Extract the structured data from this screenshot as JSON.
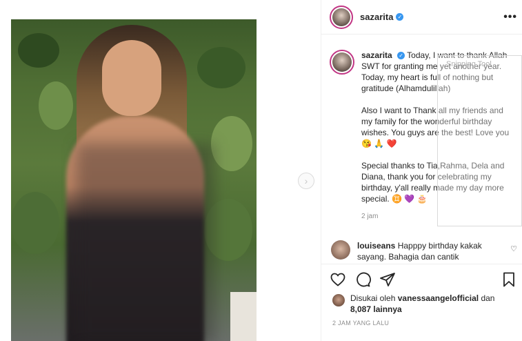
{
  "post": {
    "username": "sazarita",
    "more_label": "•••",
    "caption": {
      "paragraph1": "Today, I want to thank Allah SWT for granting me yet another year. Today, my heart is full of nothing but gratitude (Alhamdulillah)",
      "paragraph2": "Also I want to Thank all my friends and my family for the wonderful birthday wishes. You guys are the best! Love you 😘 🙏 ❤️",
      "paragraph3": "Special thanks to Tia,Rahma, Dela and Diana, thank you for celebrating my birthday, y'all really made my day more special. ♊ 💜 🎂",
      "time": "2 jam"
    },
    "comment": {
      "username": "louiseans",
      "text": "Happpy birthday kakak sayang. Bahagia dan cantik"
    },
    "likes": {
      "prefix": "Disukai oleh",
      "user": "vanessaangelofficial",
      "middle": "dan",
      "count": "8,087 lainnya"
    },
    "timestamp": "2 JAM YANG LALU"
  },
  "overlay": {
    "snipping_tool_label": "Snipping Tool"
  },
  "nav": {
    "next_label": "›"
  },
  "colors": {
    "verified": "#3897f0",
    "story_ring": "#c13584",
    "muted": "#8e8e8e"
  },
  "icons": [
    "verified-icon",
    "more-icon",
    "heart-icon",
    "comment-icon",
    "share-icon",
    "bookmark-icon",
    "chevron-right-icon"
  ]
}
